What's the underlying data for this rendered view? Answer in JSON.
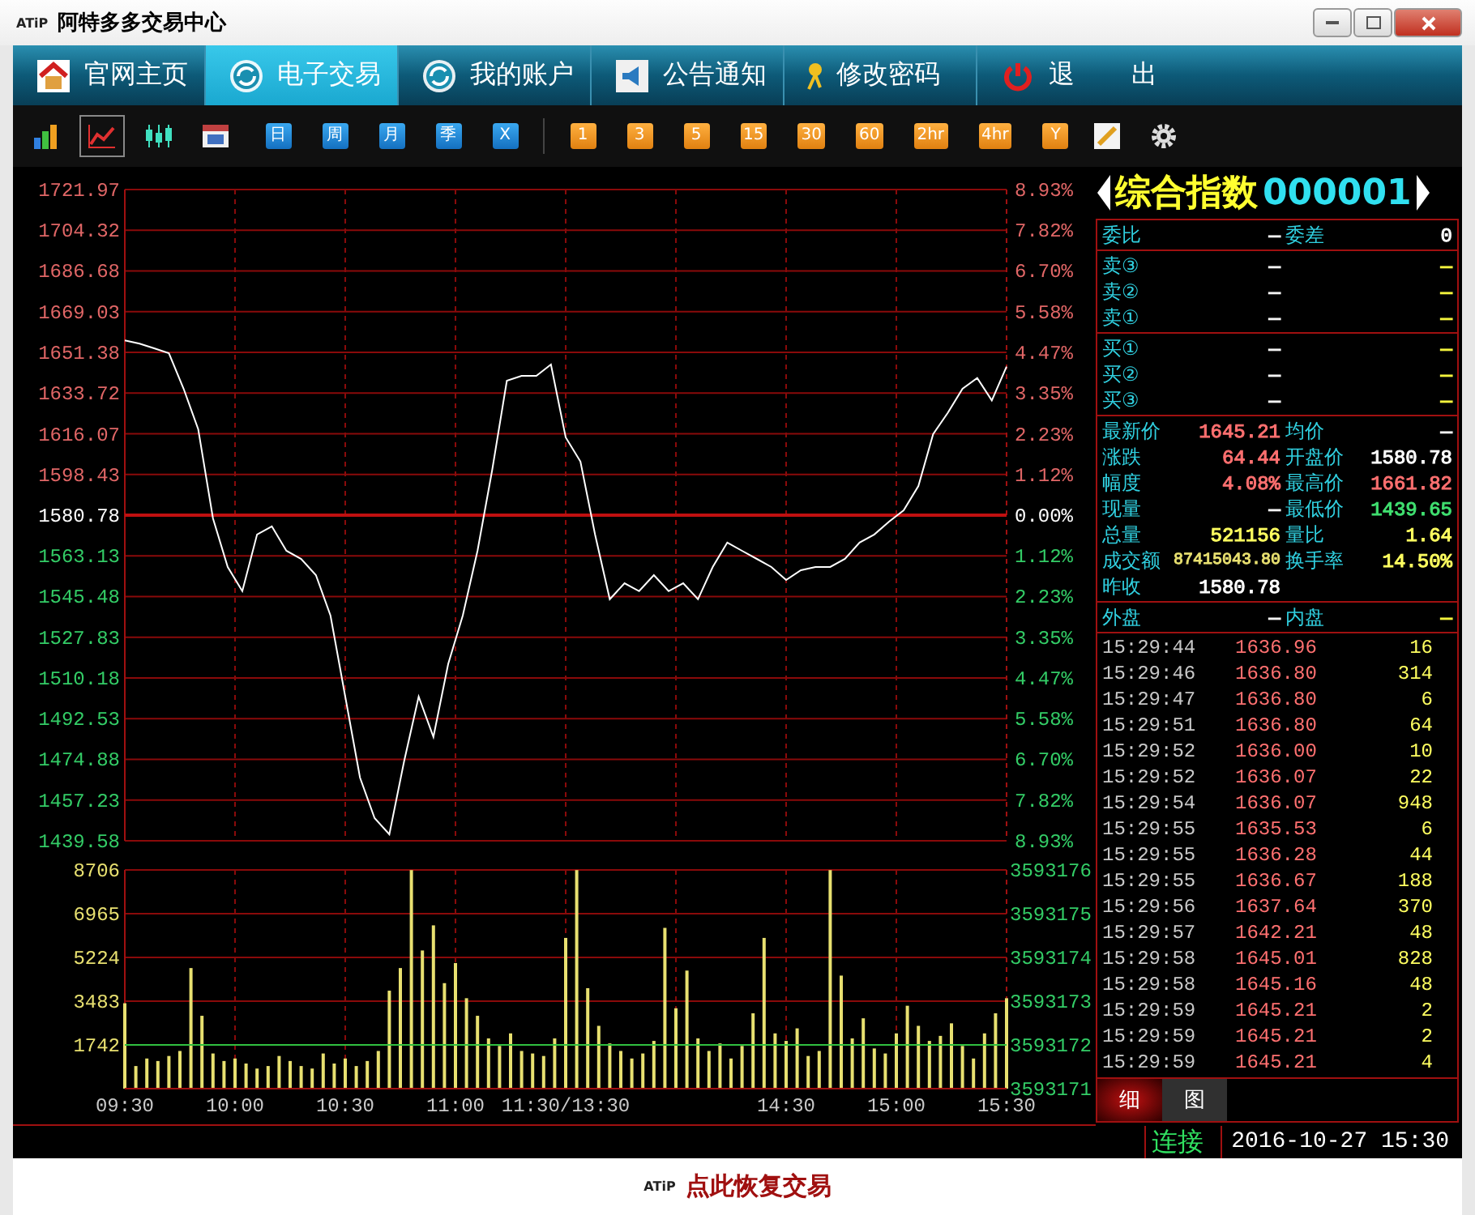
{
  "window": {
    "logo": "ATiP",
    "title": "阿特多多交易中心"
  },
  "nav": [
    {
      "label": "官网主页",
      "selected": false
    },
    {
      "label": "电子交易",
      "selected": true
    },
    {
      "label": "我的账户",
      "selected": false
    },
    {
      "label": "公告通知",
      "selected": false
    },
    {
      "label": "修改密码",
      "selected": false
    },
    {
      "label": "退 出",
      "selected": false
    }
  ],
  "chart_modes": [
    {
      "selected": false
    },
    {
      "selected": true
    },
    {
      "selected": false
    },
    {
      "selected": false
    }
  ],
  "period_buttons": [
    "日",
    "周",
    "月",
    "季",
    "X"
  ],
  "minute_buttons": [
    "1",
    "3",
    "5",
    "15",
    "30",
    "60",
    "2hr",
    "4hr",
    "Y"
  ],
  "price_chart": {
    "chart_data": {
      "type": "line",
      "grid": true,
      "ylim": [
        1439.58,
        1721.97
      ],
      "categories": [
        null,
        null,
        null,
        null,
        null,
        null,
        null,
        null,
        null,
        null,
        null,
        null,
        null,
        null,
        null,
        null,
        null,
        null,
        null,
        null,
        null,
        null,
        null,
        null,
        null,
        null,
        null,
        null,
        null,
        null,
        null,
        null,
        null,
        null,
        null,
        null,
        null,
        null,
        null,
        null,
        null,
        null,
        null,
        null,
        null,
        null,
        null,
        null,
        null,
        null,
        null,
        null,
        null,
        null,
        null,
        null,
        null,
        null,
        null,
        null,
        null
      ],
      "yticks": [
        {
          "value": 1721.97,
          "label": "1721.97"
        },
        {
          "value": 1704.32,
          "label": "1704.32"
        },
        {
          "value": 1686.68,
          "label": "1686.68"
        },
        {
          "value": 1669.03,
          "label": "1669.03"
        },
        {
          "value": 1651.38,
          "label": "1651.38"
        },
        {
          "value": 1633.72,
          "label": "1633.72"
        },
        {
          "value": 1616.07,
          "label": "1616.07"
        },
        {
          "value": 1598.43,
          "label": "1598.43"
        },
        {
          "value": 1580.78,
          "label": "1580.78"
        },
        {
          "value": 1563.13,
          "label": "1563.13"
        },
        {
          "value": 1545.48,
          "label": "1545.48"
        },
        {
          "value": 1527.83,
          "label": "1527.83"
        },
        {
          "value": 1510.18,
          "label": "1510.18"
        },
        {
          "value": 1492.53,
          "label": "1492.53"
        },
        {
          "value": 1474.88,
          "label": "1474.88"
        },
        {
          "value": 1457.23,
          "label": "1457.23"
        },
        {
          "value": 1439.58,
          "label": "1439.58"
        }
      ],
      "series": [
        {
          "color": "#ffffff",
          "values": [
            1656.6,
            1655.2,
            1653.1,
            1651.0,
            1635.6,
            1618.0,
            1579.4,
            1558.3,
            1547.8,
            1572.4,
            1575.9,
            1565.3,
            1561.8,
            1554.8,
            1537.2,
            1502.1,
            1467.0,
            1449.4,
            1442.4,
            1474.0,
            1502.1,
            1484.6,
            1516.2,
            1537.2,
            1565.3,
            1600.5,
            1639.1,
            1641.2,
            1641.2,
            1646.1,
            1614.5,
            1604.0,
            1572.4,
            1544.3,
            1551.3,
            1547.8,
            1554.8,
            1547.8,
            1551.3,
            1544.3,
            1558.3,
            1568.9,
            1565.3,
            1561.8,
            1558.3,
            1552.7,
            1556.9,
            1558.3,
            1558.3,
            1561.8,
            1568.9,
            1572.4,
            1578.0,
            1582.9,
            1593.4,
            1615.9,
            1625.1,
            1635.6,
            1640.2,
            1630.5,
            1645.2
          ]
        }
      ],
      "ref_lines": [
        {
          "axis": "y",
          "value": 1580.78,
          "color": "#c01010"
        }
      ]
    },
    "right_labels": [
      "8.93%",
      "7.82%",
      "6.70%",
      "5.58%",
      "4.47%",
      "3.35%",
      "2.23%",
      "1.12%",
      "0.00%",
      "1.12%",
      "2.23%",
      "3.35%",
      "4.47%",
      "5.58%",
      "6.70%",
      "7.82%",
      "8.93%"
    ]
  },
  "volume_chart": {
    "chart_data": {
      "type": "bar",
      "grid": true,
      "ylim": [
        0,
        8706
      ],
      "categories": [
        "09:30",
        null,
        null,
        null,
        null,
        null,
        null,
        null,
        null,
        null,
        "10:00",
        null,
        null,
        null,
        null,
        null,
        null,
        null,
        null,
        null,
        "10:30",
        null,
        null,
        null,
        null,
        null,
        null,
        null,
        null,
        null,
        "11:00",
        null,
        null,
        null,
        null,
        null,
        null,
        null,
        null,
        null,
        "11:30/13:30",
        null,
        null,
        null,
        null,
        null,
        null,
        null,
        null,
        null,
        null,
        null,
        null,
        null,
        null,
        null,
        null,
        null,
        null,
        null,
        "14:30",
        null,
        null,
        null,
        null,
        null,
        null,
        null,
        null,
        null,
        "15:00",
        null,
        null,
        null,
        null,
        null,
        null,
        null,
        null,
        null,
        "15:30"
      ],
      "yticks": [
        {
          "value": 8706,
          "label": "8706"
        },
        {
          "value": 6965,
          "label": "6965"
        },
        {
          "value": 5224,
          "label": "5224"
        },
        {
          "value": 3483,
          "label": "3483"
        },
        {
          "value": 1742,
          "label": "1742"
        }
      ],
      "series": [
        {
          "color": "#e8e070",
          "values": [
            3400,
            900,
            1200,
            1100,
            1300,
            1500,
            4800,
            2900,
            1400,
            1100,
            1200,
            1000,
            800,
            900,
            1300,
            1100,
            900,
            800,
            1400,
            1000,
            1200,
            900,
            1100,
            1500,
            3900,
            4800,
            8700,
            5500,
            6500,
            4200,
            5000,
            3600,
            2900,
            2000,
            1700,
            2200,
            1500,
            1400,
            1300,
            2000,
            6000,
            8700,
            4000,
            2500,
            1800,
            1500,
            1200,
            1400,
            1900,
            6400,
            3200,
            4700,
            2000,
            1500,
            1800,
            1200,
            1700,
            3000,
            6000,
            2200,
            1900,
            2400,
            1300,
            1500,
            8700,
            4500,
            2000,
            2800,
            1600,
            1400,
            2200,
            3300,
            2500,
            1900,
            2100,
            2600,
            1700,
            1200,
            2200,
            3000,
            3600
          ]
        }
      ],
      "ref_lines": [
        {
          "axis": "y",
          "value": 1742,
          "color": "#30c040"
        }
      ]
    },
    "right_labels": [
      "3593176",
      "3593175",
      "3593174",
      "3593173",
      "3593172",
      "3593171"
    ]
  },
  "quote": {
    "name": "综合指数",
    "code": "000001"
  },
  "ratio_row": {
    "label": "委比",
    "value": "—",
    "label2": "委差",
    "value2": "0"
  },
  "asks": [
    {
      "label": "卖③",
      "price": "—",
      "volume": "—"
    },
    {
      "label": "卖②",
      "price": "—",
      "volume": "—"
    },
    {
      "label": "卖①",
      "price": "—",
      "volume": "—"
    }
  ],
  "bids": [
    {
      "label": "买①",
      "price": "—",
      "volume": "—"
    },
    {
      "label": "买②",
      "price": "—",
      "volume": "—"
    },
    {
      "label": "买③",
      "price": "—",
      "volume": "—"
    }
  ],
  "stats": [
    {
      "cells": [
        {
          "label": "最新价",
          "value": "1645.21",
          "color": "#ff7070"
        },
        {
          "label": "均价",
          "value": "—",
          "color": "#ffffff"
        }
      ]
    },
    {
      "cells": [
        {
          "label": "涨跌",
          "value": "64.44",
          "color": "#ff7070"
        },
        {
          "label": "开盘价",
          "value": "1580.78",
          "color": "#ffffff"
        }
      ]
    },
    {
      "cells": [
        {
          "label": "幅度",
          "value": "4.08%",
          "color": "#ff7070"
        },
        {
          "label": "最高价",
          "value": "1661.82",
          "color": "#ff7070"
        }
      ]
    },
    {
      "cells": [
        {
          "label": "现量",
          "value": "—",
          "color": "#ffffff"
        },
        {
          "label": "最低价",
          "value": "1439.65",
          "color": "#40e070"
        }
      ]
    },
    {
      "cells": [
        {
          "label": "总量",
          "value": "521156",
          "color": "#ffff60"
        },
        {
          "label": "量比",
          "value": "1.64",
          "color": "#ffff60"
        }
      ]
    },
    {
      "cells": [
        {
          "label": "成交额",
          "value": "87415043.80",
          "color": "#e8e070"
        },
        {
          "label": "换手率",
          "value": "14.50%",
          "color": "#ffff60"
        }
      ]
    },
    {
      "cells": [
        {
          "label": "昨收",
          "value": "1580.78",
          "color": "#ffffff"
        }
      ]
    }
  ],
  "outer_inner": {
    "label": "外盘",
    "value": "—",
    "label2": "内盘",
    "value2": "—"
  },
  "trades": [
    {
      "time": "15:29:44",
      "price": "1636.96",
      "volume": "16"
    },
    {
      "time": "15:29:46",
      "price": "1636.80",
      "volume": "314"
    },
    {
      "time": "15:29:47",
      "price": "1636.80",
      "volume": "6"
    },
    {
      "time": "15:29:51",
      "price": "1636.80",
      "volume": "64"
    },
    {
      "time": "15:29:52",
      "price": "1636.00",
      "volume": "10"
    },
    {
      "time": "15:29:52",
      "price": "1636.07",
      "volume": "22"
    },
    {
      "time": "15:29:54",
      "price": "1636.07",
      "volume": "948"
    },
    {
      "time": "15:29:55",
      "price": "1635.53",
      "volume": "6"
    },
    {
      "time": "15:29:55",
      "price": "1636.28",
      "volume": "44"
    },
    {
      "time": "15:29:55",
      "price": "1636.67",
      "volume": "188"
    },
    {
      "time": "15:29:56",
      "price": "1637.64",
      "volume": "370"
    },
    {
      "time": "15:29:57",
      "price": "1642.21",
      "volume": "48"
    },
    {
      "time": "15:29:58",
      "price": "1645.01",
      "volume": "828"
    },
    {
      "time": "15:29:58",
      "price": "1645.16",
      "volume": "48"
    },
    {
      "time": "15:29:59",
      "price": "1645.21",
      "volume": "2"
    },
    {
      "time": "15:29:59",
      "price": "1645.21",
      "volume": "2"
    },
    {
      "time": "15:29:59",
      "price": "1645.21",
      "volume": "4"
    }
  ],
  "panel_tabs": [
    {
      "label": "细",
      "selected": true
    },
    {
      "label": "图",
      "selected": false
    }
  ],
  "status": {
    "connection": "连接",
    "datetime": "2016-10-27 15:30"
  },
  "footer": {
    "logo": "ATiP",
    "link": "点此恢复交易"
  }
}
